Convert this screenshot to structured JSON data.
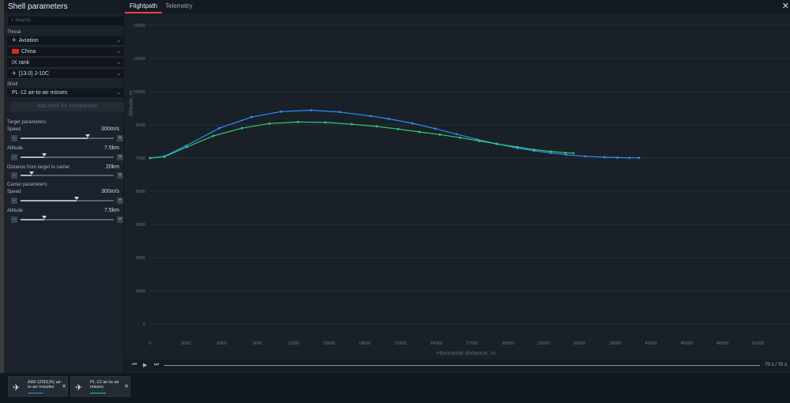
{
  "panel": {
    "title": "Shell parameters",
    "search_placeholder": "Search...",
    "threat_label": "Threat",
    "threat_type": "Aviation",
    "country": "China",
    "rank": "IX rank",
    "vehicle": "[13.0] J-10C",
    "shell_label": "Shell",
    "shell": "PL-12 air-to-air misses",
    "add_shell": "Add shell for comparison",
    "target_params_label": "Target parameters:",
    "carrier_params_label": "Carrier parameters:",
    "sliders": [
      {
        "label": "Speed",
        "value": "300m/s",
        "level": 0.72
      },
      {
        "label": "Altitude",
        "value": "7.5km",
        "level": 0.25
      },
      {
        "label": "Distance from target to carrier",
        "value": "20km",
        "level": 0.12
      },
      {
        "label": "Speed",
        "value": "300m/s",
        "level": 0.6
      },
      {
        "label": "Altitude",
        "value": "7.5km",
        "level": 0.25
      }
    ],
    "minus": "-",
    "plus": "+"
  },
  "tabs": [
    {
      "label": "Flightpath",
      "active": true
    },
    {
      "label": "Telemetry",
      "active": false
    }
  ],
  "close_icon": "close-icon",
  "transport": {
    "time": "70 s  /  70 s"
  },
  "shells": [
    {
      "name": "AIM-120D(Jh) air-to-air missiles",
      "color": "#2f8cff"
    },
    {
      "name": "PL-12 air-to-air misses",
      "color": "#2ecc71"
    }
  ],
  "chart_data": {
    "type": "line",
    "xlabel": "Horizontal distance, m",
    "ylabel": "Altitude, m",
    "xticks": [
      0,
      3000,
      6000,
      9000,
      12000,
      15000,
      18000,
      21000,
      24000,
      27000,
      30000,
      33000,
      36000,
      39000,
      42000,
      45000,
      48000,
      51000
    ],
    "yticks": [
      0,
      1500,
      3000,
      4500,
      6000,
      7500,
      9000,
      10500,
      12000,
      13500
    ],
    "xlim": [
      0,
      53000
    ],
    "ylim": [
      0,
      13500
    ],
    "grid": true,
    "series": [
      {
        "name": "AIM-120D(Jh) air-to-air missiles",
        "color": "#2f8cff",
        "points": [
          [
            0,
            7500
          ],
          [
            1200,
            7580
          ],
          [
            3000,
            8050
          ],
          [
            5800,
            8850
          ],
          [
            8500,
            9350
          ],
          [
            11000,
            9600
          ],
          [
            13500,
            9660
          ],
          [
            15900,
            9580
          ],
          [
            18500,
            9400
          ],
          [
            20000,
            9270
          ],
          [
            22000,
            9070
          ],
          [
            23900,
            8830
          ],
          [
            25700,
            8580
          ],
          [
            27400,
            8350
          ],
          [
            29000,
            8150
          ],
          [
            30800,
            7950
          ],
          [
            32200,
            7830
          ],
          [
            33600,
            7730
          ],
          [
            34900,
            7650
          ],
          [
            36500,
            7580
          ],
          [
            38100,
            7540
          ],
          [
            39200,
            7520
          ],
          [
            40200,
            7510
          ],
          [
            41000,
            7510
          ]
        ]
      },
      {
        "name": "PL-12 air-to-air misses",
        "color": "#2ecc71",
        "points": [
          [
            0,
            7500
          ],
          [
            1200,
            7560
          ],
          [
            3100,
            8000
          ],
          [
            5300,
            8500
          ],
          [
            7700,
            8850
          ],
          [
            10000,
            9060
          ],
          [
            12400,
            9130
          ],
          [
            14700,
            9110
          ],
          [
            16900,
            9030
          ],
          [
            19000,
            8930
          ],
          [
            20800,
            8810
          ],
          [
            22600,
            8680
          ],
          [
            24300,
            8560
          ],
          [
            26000,
            8420
          ],
          [
            27600,
            8270
          ],
          [
            29100,
            8140
          ],
          [
            30800,
            8000
          ],
          [
            32200,
            7880
          ],
          [
            33600,
            7800
          ],
          [
            34800,
            7740
          ],
          [
            35500,
            7720
          ]
        ]
      }
    ]
  }
}
